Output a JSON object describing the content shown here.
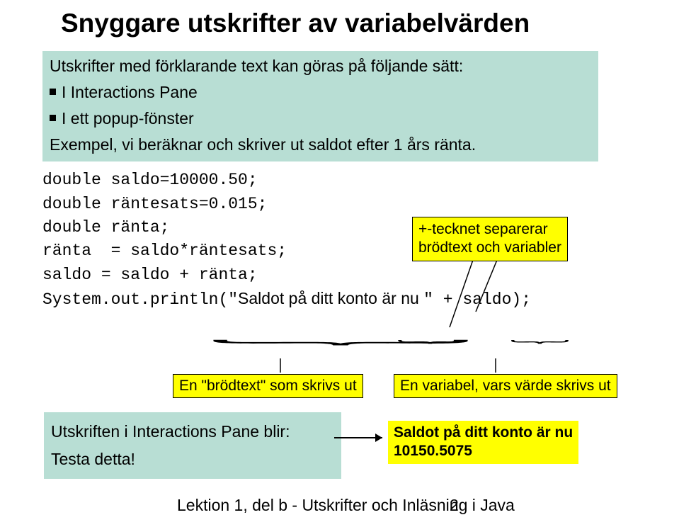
{
  "title": "Snyggare utskrifter av variabelvärden",
  "intro": {
    "lead": "Utskrifter med förklarande text kan göras på följande sätt:",
    "bullet1": "I Interactions Pane",
    "bullet2": "I ett popup-fönster",
    "example": "Exempel,  vi beräknar och skriver ut saldot efter 1 års ränta."
  },
  "code": {
    "l1": "double saldo=10000.50;",
    "l2": "double räntesats=0.015;",
    "l3": "double ränta;",
    "l4": "ränta  = saldo*räntesats;",
    "l5": "saldo = saldo + ränta;",
    "l6a": "System.out.println(\"",
    "l6b": "Saldot på ditt konto är nu ",
    "l6c": "\" + saldo);"
  },
  "notes": {
    "plus": "+-tecknet  separerar\nbrödtext och variabler",
    "brod": "En \"brödtext\" som skrivs ut",
    "varout": "En variabel, vars värde skrivs ut",
    "utskrift_l1": "Utskriften i Interactions Pane blir:",
    "utskrift_l2": "Testa detta!",
    "saldo_l1": "Saldot på ditt konto är nu",
    "saldo_l2": "10150.5075"
  },
  "footer": "Lektion 1, del b - Utskrifter och Inläsning i Java",
  "page_number": "2"
}
